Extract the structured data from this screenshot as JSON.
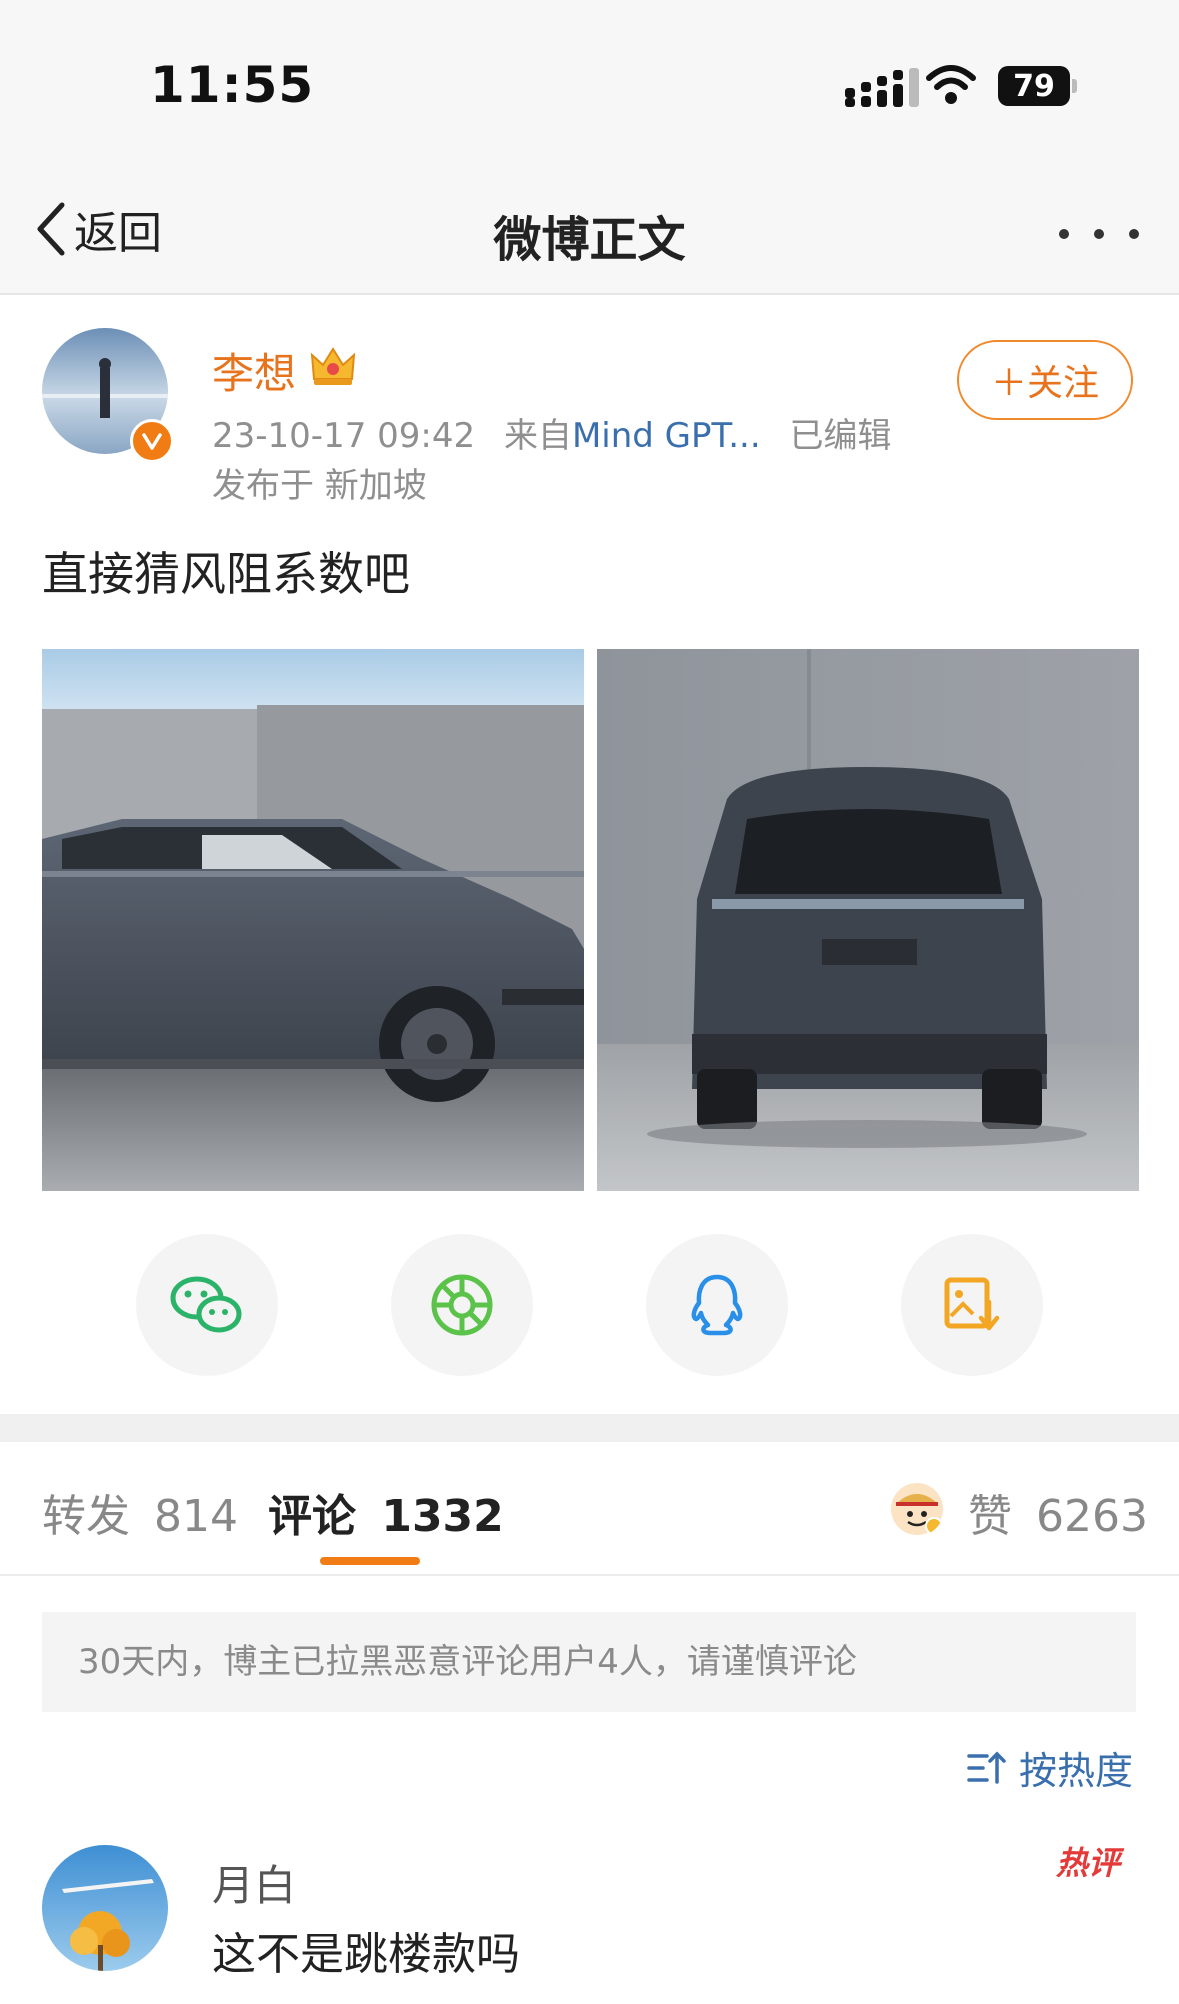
{
  "status_bar": {
    "time": "11:55",
    "battery": "79"
  },
  "nav": {
    "back_label": "返回",
    "title": "微博正文"
  },
  "post": {
    "author": "李想",
    "date": "23-10-17 09:42",
    "source_prefix": "来自",
    "source": "Mind GPT...",
    "edited": "已编辑",
    "location": "发布于 新加坡",
    "follow_label": "＋关注",
    "text": "直接猜风阻系数吧"
  },
  "share": {
    "items": [
      "wechat-icon",
      "moments-icon",
      "qq-icon",
      "save-image-icon"
    ]
  },
  "tabs": {
    "repost_label": "转发",
    "repost_count": "814",
    "comments_label": "评论",
    "comments_count": "1332",
    "likes_label": "赞",
    "likes_count": "6263"
  },
  "notice": "30天内，博主已拉黑恶意评论用户4人，请谨慎评论",
  "sort_label": "按热度",
  "comment": {
    "author": "月白",
    "text": "这不是跳楼款吗",
    "badge": "热评"
  },
  "colors": {
    "accent": "#f07c13",
    "link": "#3a6fae",
    "name": "#e8731d"
  }
}
